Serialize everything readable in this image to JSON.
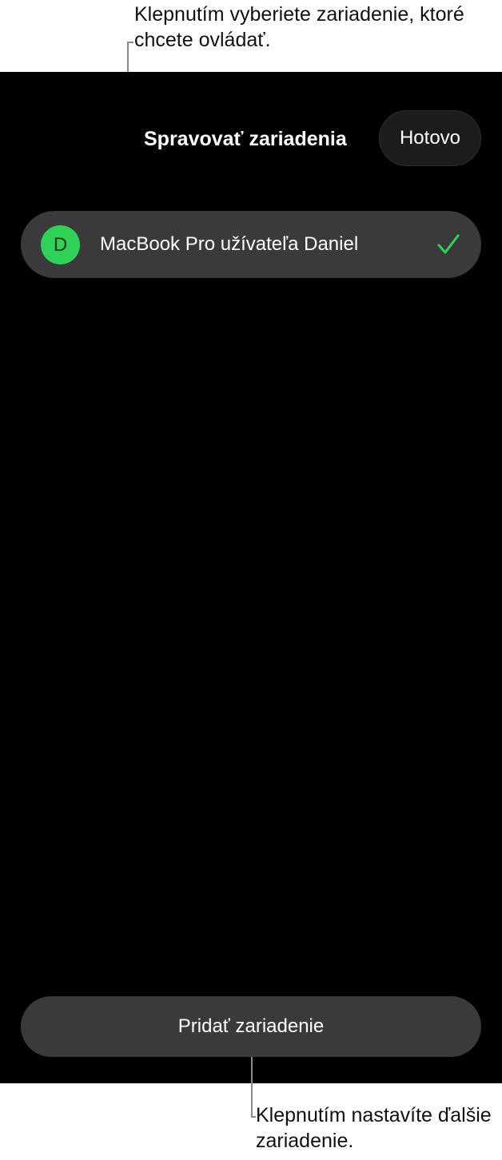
{
  "callouts": {
    "top": "Klepnutím vyberiete zariadenie, ktoré chcete ovládať.",
    "bottom": "Klepnutím nastavíte ďalšie zariadenie."
  },
  "header": {
    "title": "Spravovať zariadenia",
    "done_label": "Hotovo"
  },
  "devices": [
    {
      "avatar_letter": "D",
      "name": "MacBook Pro užívateľa Daniel",
      "selected": true,
      "check_icon": "checkmark-icon"
    }
  ],
  "footer": {
    "add_label": "Pridať zariadenie"
  },
  "colors": {
    "background": "#000000",
    "row": "#3a3a3c",
    "button": "#1c1c1e",
    "accent_green": "#30d158"
  }
}
